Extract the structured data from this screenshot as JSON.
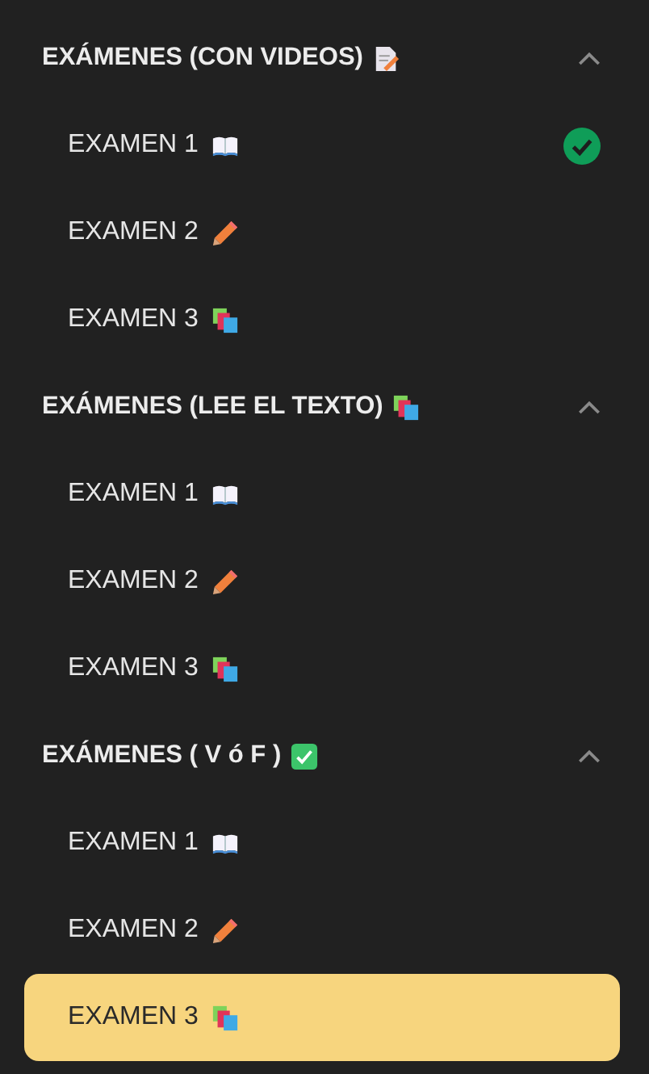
{
  "sections": [
    {
      "title": "EXÁMENES (CON VIDEOS)",
      "expanded": true,
      "items": [
        {
          "label": "EXAMEN 1",
          "completed": true,
          "selected": false
        },
        {
          "label": "EXAMEN 2",
          "completed": false,
          "selected": false
        },
        {
          "label": "EXAMEN 3",
          "completed": false,
          "selected": false
        }
      ]
    },
    {
      "title": "EXÁMENES (LEE EL TEXTO)",
      "expanded": true,
      "items": [
        {
          "label": "EXAMEN 1",
          "completed": false,
          "selected": false
        },
        {
          "label": "EXAMEN 2",
          "completed": false,
          "selected": false
        },
        {
          "label": "EXAMEN 3",
          "completed": false,
          "selected": false
        }
      ]
    },
    {
      "title": "EXÁMENES ( V ó F )",
      "expanded": true,
      "items": [
        {
          "label": "EXAMEN 1",
          "completed": false,
          "selected": false
        },
        {
          "label": "EXAMEN 2",
          "completed": false,
          "selected": false
        },
        {
          "label": "EXAMEN 3",
          "completed": false,
          "selected": true
        }
      ]
    }
  ]
}
